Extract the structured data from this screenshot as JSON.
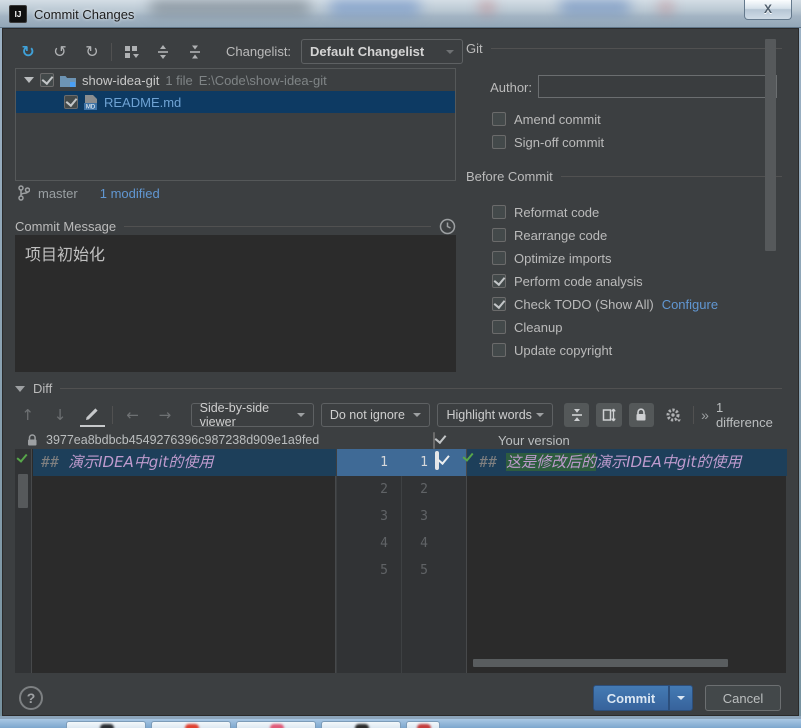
{
  "window": {
    "title": "Commit Changes"
  },
  "toolbar": {
    "changelist_label": "Changelist:",
    "changelist_value": "Default Changelist"
  },
  "tree": {
    "root_name": "show-idea-git",
    "root_count": "1 file",
    "root_path": "E:\\Code\\show-idea-git",
    "file_name": "README.md"
  },
  "vcs": {
    "branch": "master",
    "modified": "1 modified"
  },
  "commit": {
    "label": "Commit Message",
    "message": "项目初始化"
  },
  "git_panel": {
    "title": "Git",
    "author_label": "Author:",
    "author_value": "",
    "amend_label": "Amend commit",
    "signoff_label": "Sign-off commit"
  },
  "before_commit": {
    "title": "Before Commit",
    "items": [
      {
        "label": "Reformat code",
        "checked": false
      },
      {
        "label": "Rearrange code",
        "checked": false
      },
      {
        "label": "Optimize imports",
        "checked": false
      },
      {
        "label": "Perform code analysis",
        "checked": true
      },
      {
        "label": "Check TODO (Show All)",
        "checked": true,
        "link": "Configure"
      },
      {
        "label": "Cleanup",
        "checked": false
      },
      {
        "label": "Update copyright",
        "checked": false
      }
    ]
  },
  "diff": {
    "title": "Diff",
    "viewer_mode": "Side-by-side viewer",
    "ignore_mode": "Do not ignore",
    "highlight_mode": "Highlight words",
    "differences": "1 difference",
    "left_revision": "3977ea8bdbcb4549276396c987238d909e1a9fed",
    "right_title": "Your version",
    "left_line": {
      "prefix": "##",
      "text": "演示IDEA中git的使用"
    },
    "right_line": {
      "prefix": "##",
      "inserted": "这是修改后的",
      "text": "演示IDEA中git的使用"
    },
    "gutter_rows": [
      {
        "l": "1",
        "r": "1"
      },
      {
        "l": "2",
        "r": "2"
      },
      {
        "l": "3",
        "r": "3"
      },
      {
        "l": "4",
        "r": "4"
      },
      {
        "l": "5",
        "r": "5"
      }
    ]
  },
  "footer": {
    "help": "?",
    "commit": "Commit",
    "cancel": "Cancel"
  },
  "colors": {
    "panel_bg": "#3c3f41",
    "editor_bg": "#2b2b2b",
    "selection": "#0d3a63",
    "diff_row": "#1d3f5a",
    "diff_gutter_row": "#3f6a96",
    "inserted_bg": "#2d5c3f",
    "link": "#6197d2",
    "commit_button": "#37639c",
    "md_heading": "#bf9bce"
  }
}
